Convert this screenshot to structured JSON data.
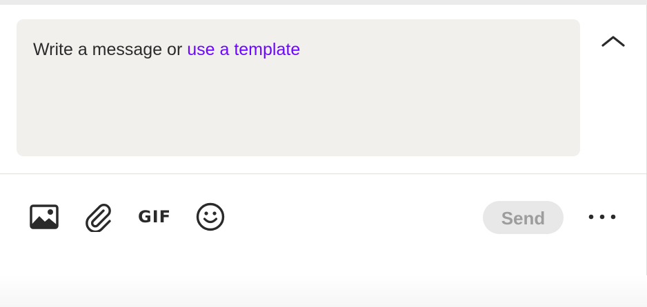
{
  "composer": {
    "placeholder_prefix": "Write a message or ",
    "template_link": "use a template",
    "collapse_icon": "chevron-up-icon"
  },
  "toolbar": {
    "image_icon": "image-icon",
    "attach_icon": "paperclip-icon",
    "gif_label": "GIF",
    "emoji_icon": "emoji-icon",
    "send_label": "Send",
    "more_icon": "more-horizontal-icon"
  },
  "colors": {
    "link": "#6c08ff",
    "input_bg": "#f2f0ed",
    "send_disabled_bg": "#e8e8e8",
    "send_disabled_text": "#9d9d9d"
  }
}
